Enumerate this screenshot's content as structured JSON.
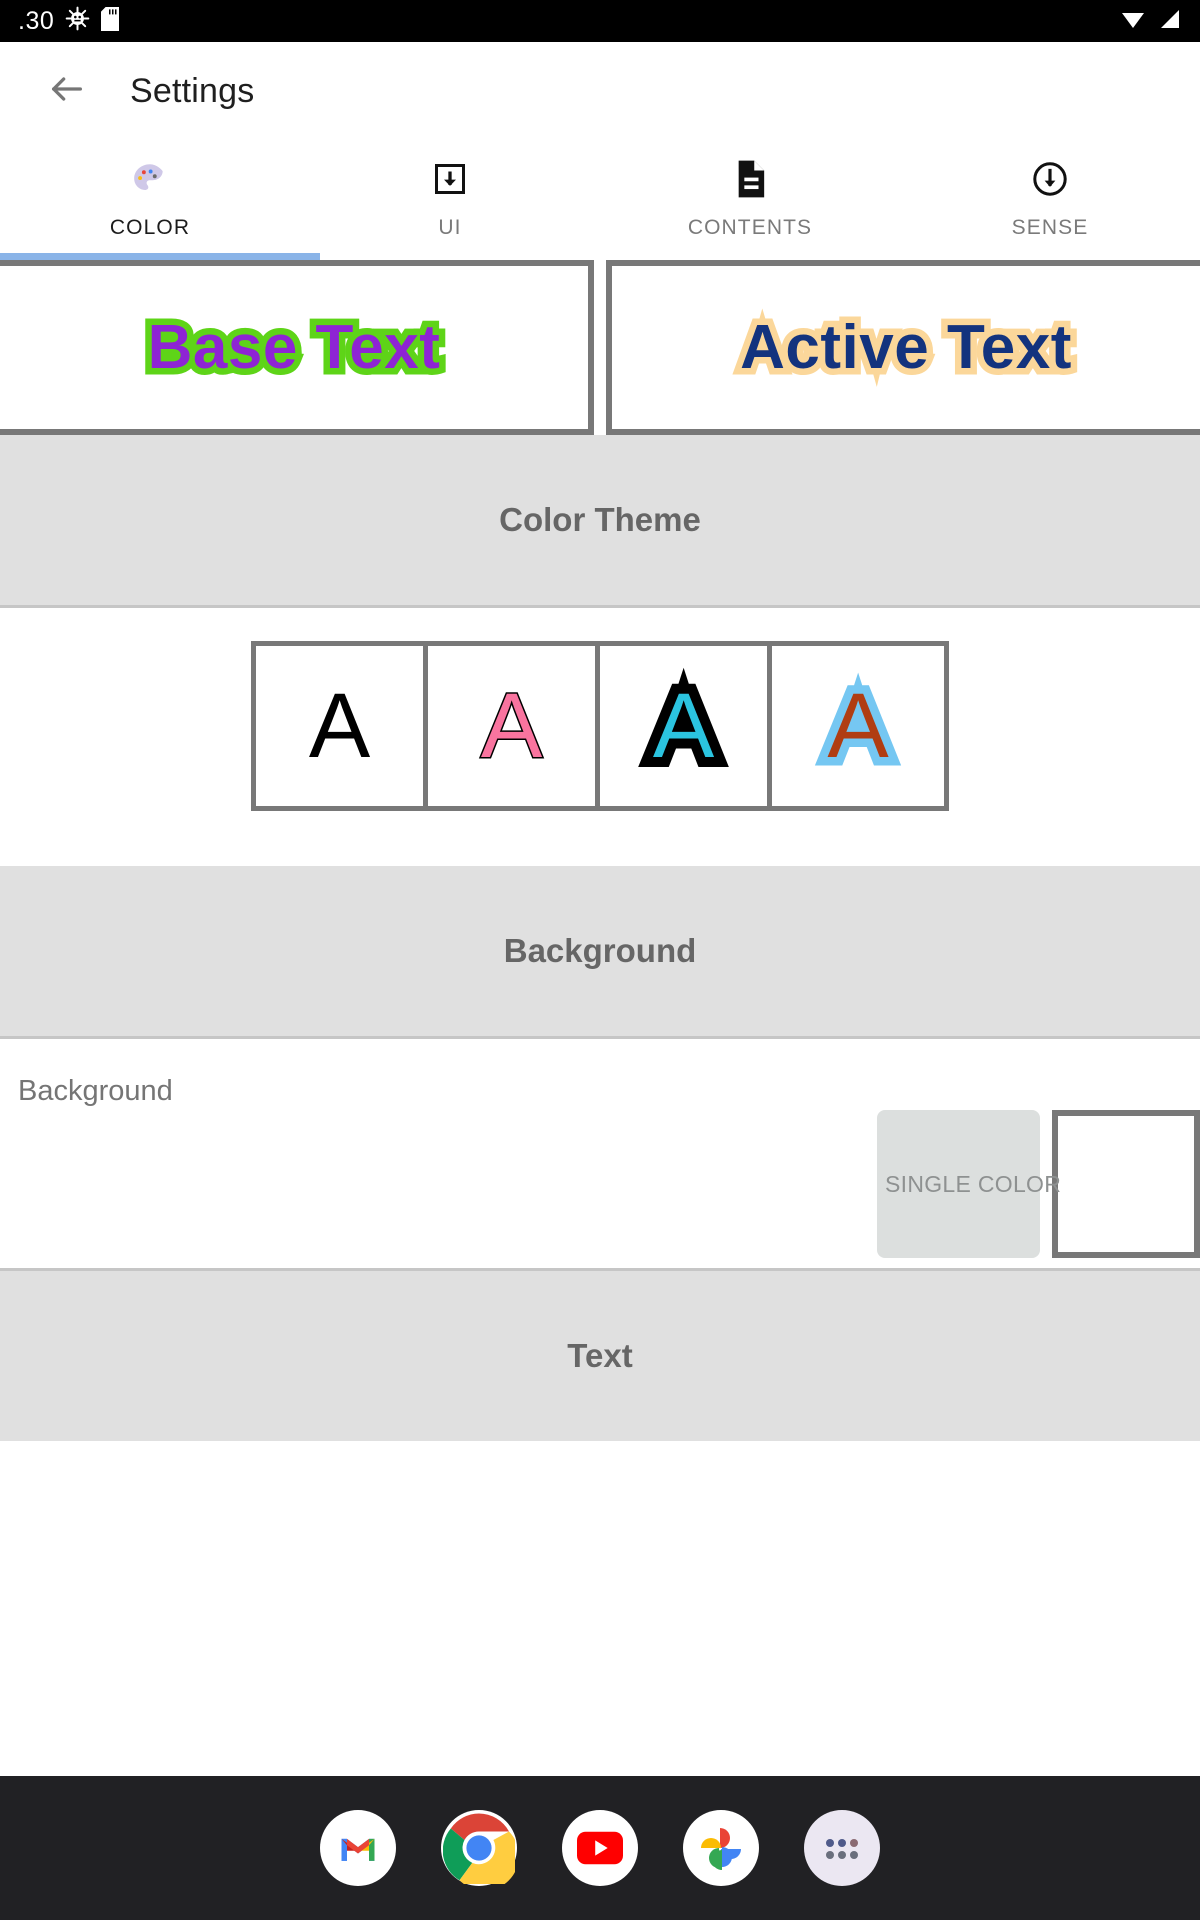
{
  "statusbar": {
    "clock": ".30",
    "icons_left": [
      "android-bug-icon",
      "sd-card-icon"
    ],
    "icons_right": [
      "wifi-icon",
      "signal-icon"
    ]
  },
  "appbar": {
    "back_icon": "back-arrow-icon",
    "title": "Settings"
  },
  "tabs": [
    {
      "label": "COLOR",
      "icon": "palette-icon",
      "active": true
    },
    {
      "label": "UI",
      "icon": "download-box-icon",
      "active": false
    },
    {
      "label": "CONTENTS",
      "icon": "document-icon",
      "active": false
    },
    {
      "label": "SENSE",
      "icon": "circle-down-arrow-icon",
      "active": false
    }
  ],
  "preview": {
    "base": {
      "text": "Base Text",
      "fill_color": "#8e24d4",
      "outline_color": "#5ed418"
    },
    "active": {
      "text": "Active Text",
      "fill_color": "#13337e",
      "outline_color": "#fbd79a"
    }
  },
  "sections": {
    "color_theme": {
      "header": "Color Theme",
      "swatches": [
        {
          "glyph": "A",
          "fill_color": "#000000",
          "outline_color": "none"
        },
        {
          "glyph": "A",
          "fill_color": "#f9749f",
          "outline_color": "#000000"
        },
        {
          "glyph": "A",
          "fill_color": "#2bc4e0",
          "outline_color": "#000000"
        },
        {
          "glyph": "A",
          "fill_color": "#b03d12",
          "outline_color": "#75c7f2"
        }
      ]
    },
    "background": {
      "header": "Background",
      "row_label": "Background",
      "mode_button": "SINGLE COLOR",
      "swatch_color": "#ffffff"
    },
    "text": {
      "header": "Text"
    }
  },
  "dock": {
    "apps": [
      {
        "name": "gmail-icon"
      },
      {
        "name": "chrome-icon"
      },
      {
        "name": "youtube-icon"
      },
      {
        "name": "google-photos-icon"
      },
      {
        "name": "app-drawer-icon"
      }
    ]
  },
  "colors": {
    "accent": "#8ab4e8",
    "section_bg": "#e0e0e0",
    "border": "#787878"
  }
}
